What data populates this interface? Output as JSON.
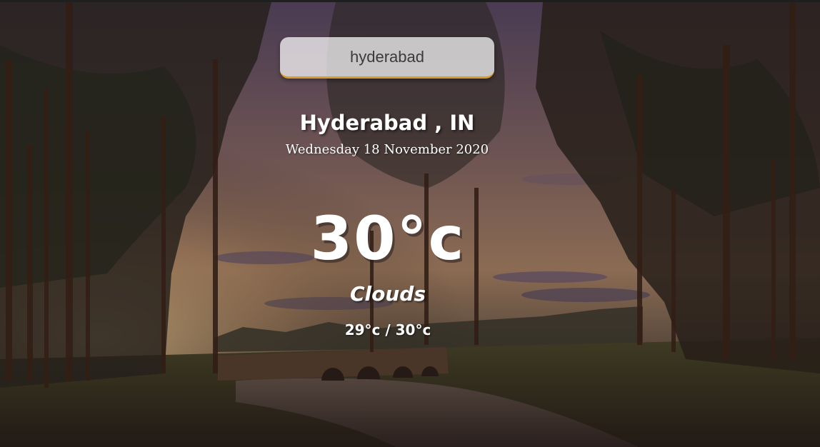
{
  "search": {
    "value": "hyderabad"
  },
  "weather": {
    "location": "Hyderabad , IN",
    "date": "Wednesday 18 November 2020",
    "temperature": "30°c",
    "condition": "Clouds",
    "range": "29°c / 30°c"
  },
  "colors": {
    "text": "#ffffff",
    "search_accent": "#d99a2b"
  },
  "background": {
    "scene": "forest-sunset-river-bridge"
  }
}
